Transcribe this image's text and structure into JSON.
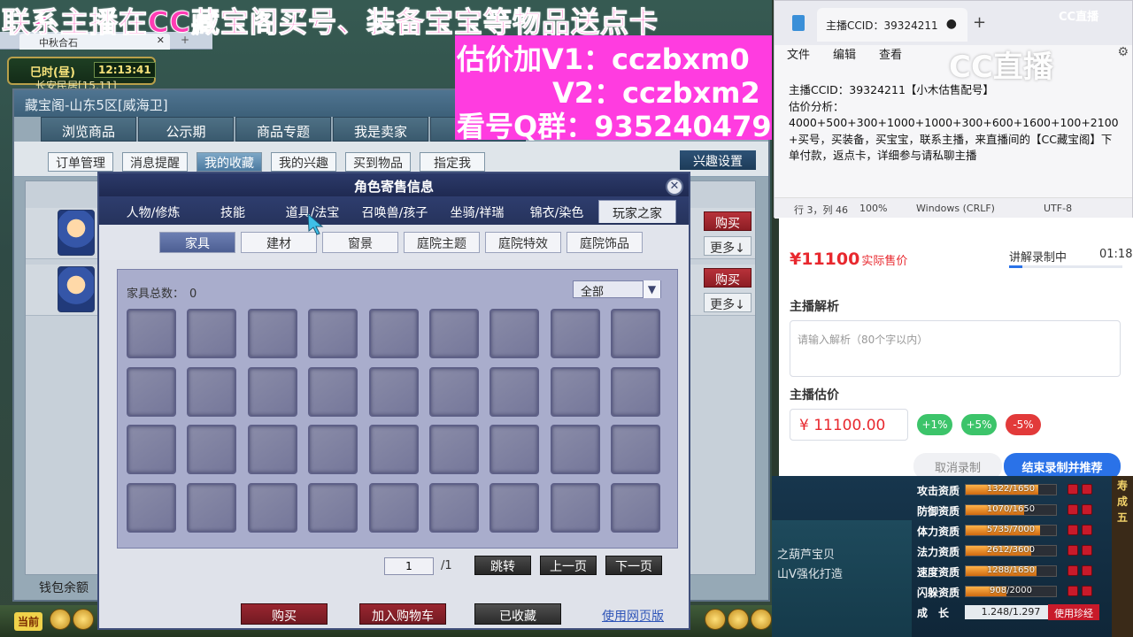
{
  "promo": {
    "line1": "联系主播在CC藏宝阁买号、装备宝宝等物品送点卡",
    "v1": "估价加V1：cczbxm0",
    "v2": "V2：cczbxm2",
    "qq": "看号Q群：935240479"
  },
  "game": {
    "tab_title": "中秋合石",
    "time_period": "巳时(昼)",
    "clock": "12:13:41",
    "location": "长安民居[15,11]"
  },
  "cbg": {
    "title": "藏宝阁-山东5区[威海卫]",
    "tabs": [
      "浏览商品",
      "公示期",
      "商品专题",
      "我是卖家",
      "我"
    ],
    "subtabs": [
      "订单管理",
      "消息提醒",
      "我的收藏",
      "我的兴趣",
      "买到物品",
      "指定我"
    ],
    "interest_settings": "兴趣设置",
    "buy": "购买",
    "more": "更多↓",
    "wallet": "钱包余额"
  },
  "dialog": {
    "title": "角色寄售信息",
    "tabs": [
      "人物/修炼",
      "技能",
      "道具/法宝",
      "召唤兽/孩子",
      "坐骑/祥瑞",
      "锦衣/染色",
      "玩家之家"
    ],
    "categories": [
      "家具",
      "建材",
      "窗景",
      "庭院主题",
      "庭院特效",
      "庭院饰品"
    ],
    "furniture_total_label": "家具总数：",
    "furniture_total": "0",
    "filter_value": "全部",
    "page_current": "1",
    "page_total": "/1",
    "jump": "跳转",
    "prev": "上一页",
    "next": "下一页",
    "buy": "购买",
    "add_cart": "加入购物车",
    "favorited": "已收藏",
    "web_link": "使用网页版"
  },
  "notepad": {
    "tab_title": "主播CCID：39324211",
    "menu": [
      "文件",
      "编辑",
      "查看"
    ],
    "line1": "主播CCID：39324211【小木估售配号】",
    "line2": "估价分析：",
    "line3": "4000+500+300+1000+1000+300+600+1600+100+2100+买号，买装备，买宝宝，联系主播，来直播间的【CC藏宝阁】下单付款，返点卡，详细参与请私聊主播",
    "status_pos": "行 3，列 46",
    "status_zoom": "100%",
    "status_eol": "Windows (CRLF)",
    "status_enc": "UTF-8"
  },
  "cc_logo": "CC直播",
  "cc_logo_small": "CC直播",
  "estimate": {
    "price": "¥11100",
    "price_label": "实际售价",
    "rec_status": "讲解录制中",
    "rec_time": "01:18",
    "rec_progress": 0.12,
    "analysis_heading": "主播解析",
    "analysis_placeholder": "请输入解析（80个字以内）",
    "estimate_heading": "主播估价",
    "estimate_value": "¥ 11100.00",
    "plus1": "+1%",
    "plus5": "+5%",
    "minus5": "-5%",
    "cancel": "取消录制",
    "finish": "结束录制并推荐"
  },
  "stats": {
    "side_lines": [
      "之葫芦宝贝",
      "山Ⅴ强化打造"
    ],
    "rows": [
      {
        "label": "攻击资质",
        "value": "1322/1650",
        "fill": 0.8
      },
      {
        "label": "防御资质",
        "value": "1070/1650",
        "fill": 0.65
      },
      {
        "label": "体力资质",
        "value": "5735/7000",
        "fill": 0.82
      },
      {
        "label": "法力资质",
        "value": "2612/3600",
        "fill": 0.73
      },
      {
        "label": "速度资质",
        "value": "1288/1650",
        "fill": 0.78
      },
      {
        "label": "闪躲资质",
        "value": "908/2000",
        "fill": 0.45
      }
    ],
    "growth_label": "成　长",
    "growth_value": "1.248/1.297",
    "growth_button": "使用珍经",
    "right_chars": [
      "寿",
      "成",
      "五"
    ]
  },
  "bottom": {
    "current": "当前"
  },
  "colors": {
    "promo_pink": "#ff3cb4",
    "accent_blue": "#2a72e8",
    "price_red": "#e8282e"
  }
}
